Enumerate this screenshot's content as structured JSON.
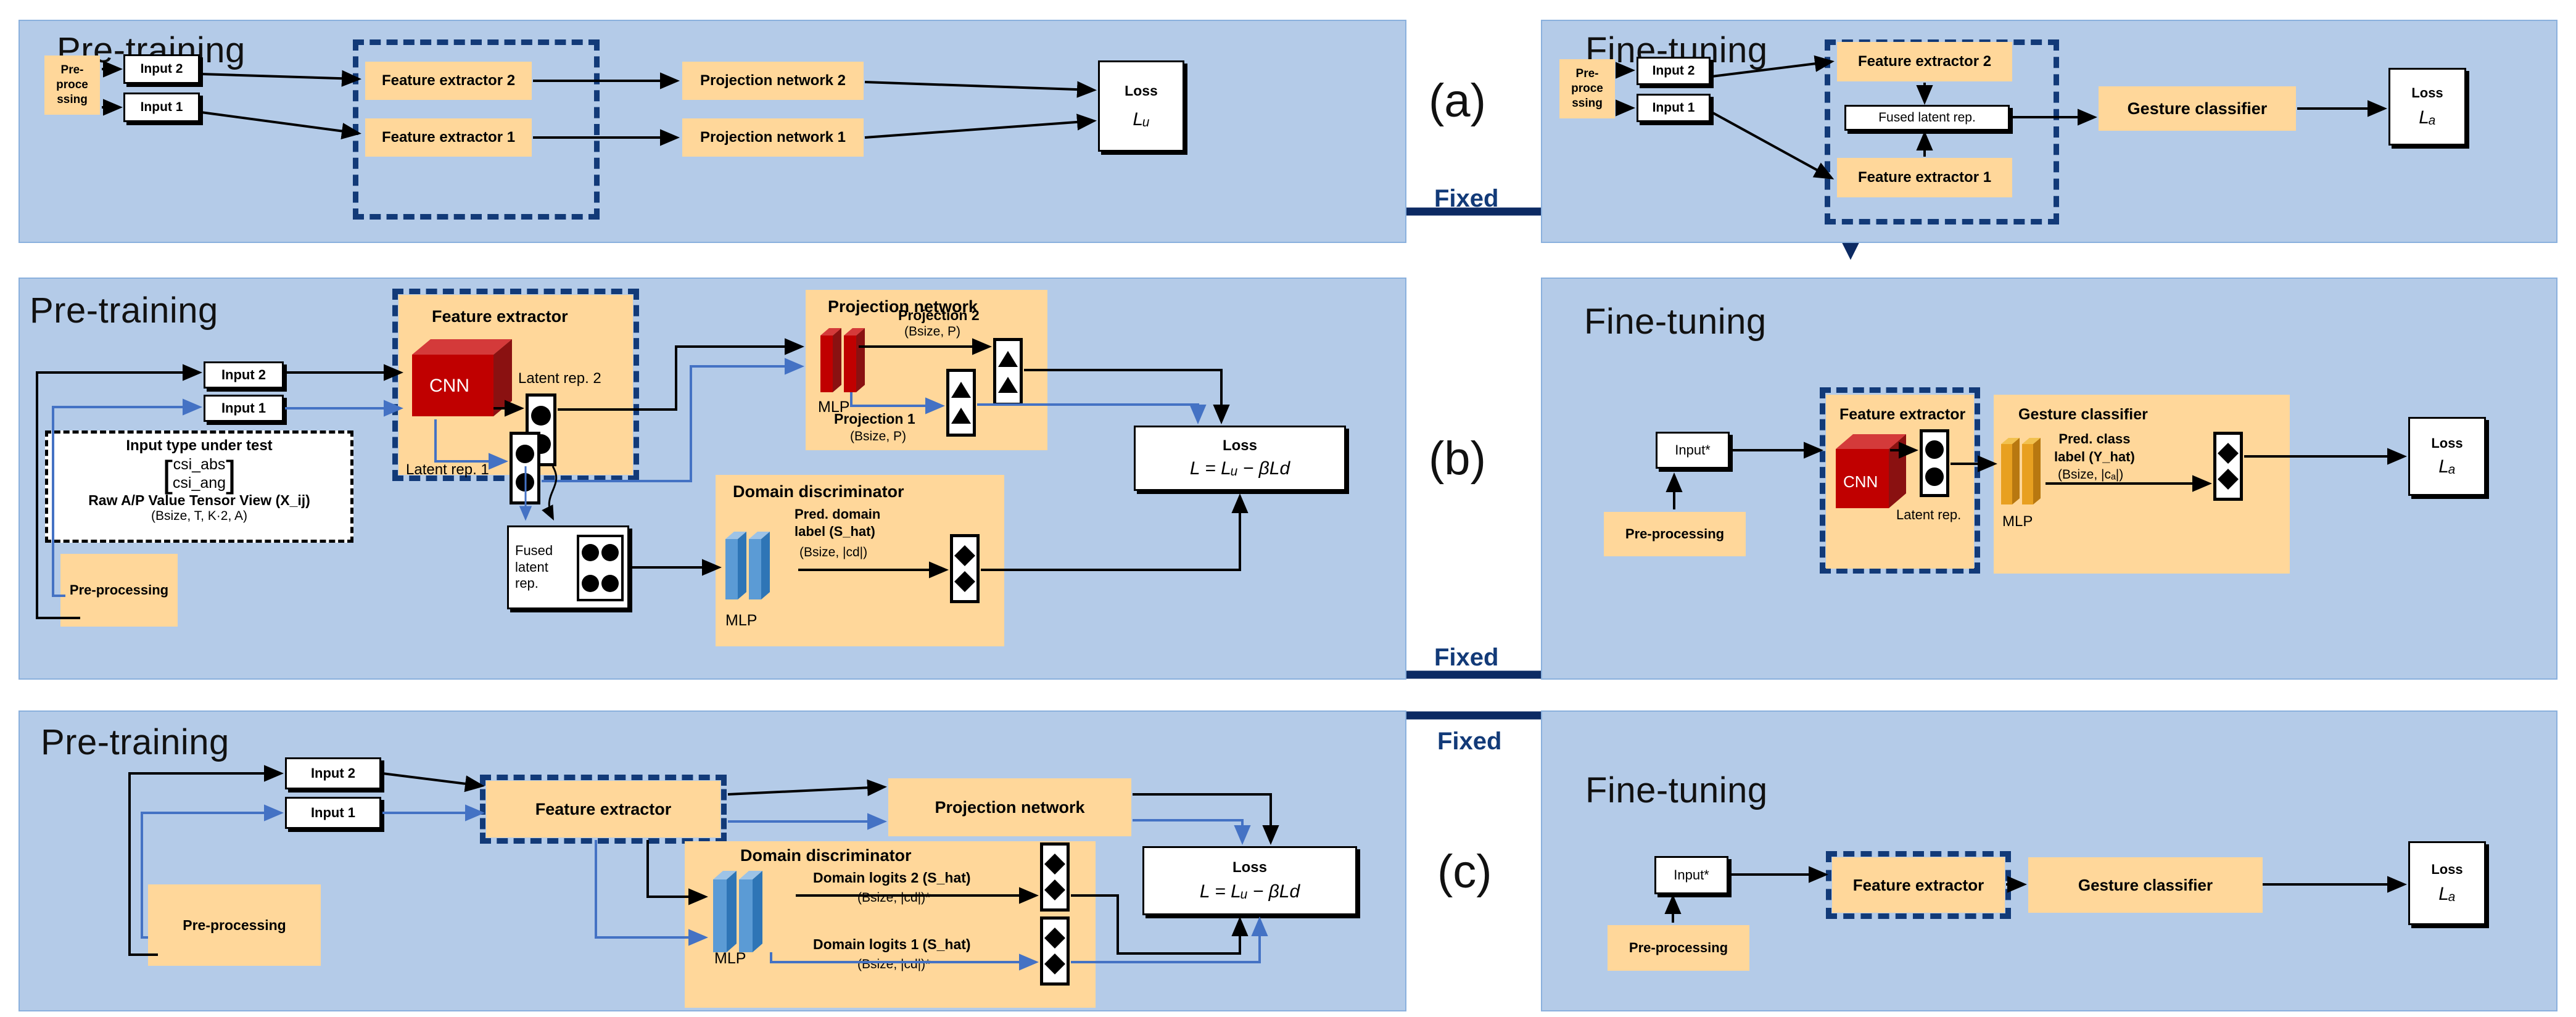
{
  "figure": {
    "panel_tags": [
      "(a)",
      "(b)",
      "(c)"
    ],
    "fixed_label": "Fixed",
    "stage_titles": {
      "pretrain": "Pre-training",
      "finetune": "Fine-tuning"
    }
  },
  "colors": {
    "panel_bg": "#b4cbe8",
    "block_orange": "#ffd79a",
    "cnn_red": "#c00000",
    "mlp_blue": "#5b9bd5",
    "mlp_gold": "#e8a020",
    "fixed_navy": "#0c2a63",
    "flow1_blue": "#4472c4",
    "flow2_black": "#000000"
  },
  "panel_a": {
    "left": {
      "title": "Pre-training",
      "preprocessing": "Pre-\nproce\nssing",
      "inputs": [
        "Input 2",
        "Input 1"
      ],
      "feature_extractors": [
        "Feature extractor 2",
        "Feature extractor 1"
      ],
      "projection_networks": [
        "Projection network 2",
        "Projection network 1"
      ],
      "loss": {
        "label": "Loss",
        "formula": "Lᵤ"
      }
    },
    "right": {
      "title": "Fine-tuning",
      "preprocessing": "Pre-\nproce\nssing",
      "inputs": [
        "Input 2",
        "Input 1"
      ],
      "feature_extractors": [
        "Feature extractor 2",
        "Feature extractor 1"
      ],
      "fused_latent": "Fused latent rep.",
      "gesture_classifier": "Gesture classifier",
      "loss": {
        "label": "Loss",
        "formula": "Lₐ"
      }
    }
  },
  "panel_b": {
    "left": {
      "title": "Pre-training",
      "preprocessing": "Pre-processing",
      "inputs": [
        "Input 2",
        "Input 1"
      ],
      "note": {
        "heading": "Input type under test",
        "matrix_rows": [
          "csi_abs",
          "csi_ang"
        ],
        "caption": "Raw A/P Value Tensor View (X_ij)",
        "shape": "(Bsize, T, K·2, A)"
      },
      "feature_extractor": {
        "title": "Feature extractor",
        "core": "CNN",
        "latent_2": "Latent rep. 2",
        "latent_1": "Latent rep. 1"
      },
      "fused_latent": "Fused\nlatent\nrep.",
      "projection_network": {
        "title": "Projection network",
        "core": "MLP",
        "proj_2_label": "Projection 2",
        "proj_2_shape": "(Bsize, P)",
        "proj_1_label": "Projection 1",
        "proj_1_shape": "(Bsize, P)"
      },
      "domain_discriminator": {
        "title": "Domain discriminator",
        "core": "MLP",
        "output_label": "Pred. domain\nlabel (S_hat)",
        "output_shape": "(Bsize, |cd|)"
      },
      "loss": {
        "label": "Loss",
        "formula": "L = Lᵤ − βLd"
      }
    },
    "right": {
      "title": "Fine-tuning",
      "preprocessing": "Pre-processing",
      "input": "Input*",
      "feature_extractor": {
        "title": "Feature extractor",
        "core": "CNN",
        "latent": "Latent rep."
      },
      "gesture_classifier": {
        "title": "Gesture classifier",
        "core": "MLP",
        "output_label": "Pred. class\nlabel (Y_hat)",
        "output_shape": "(Bsize, |cₐ|)"
      },
      "loss": {
        "label": "Loss",
        "formula": "Lₐ"
      }
    }
  },
  "panel_c": {
    "left": {
      "title": "Pre-training",
      "preprocessing": "Pre-processing",
      "inputs": [
        "Input 2",
        "Input 1"
      ],
      "feature_extractor": "Feature extractor",
      "projection_network": "Projection network",
      "domain_discriminator": {
        "title": "Domain discriminator",
        "core": "MLP",
        "logits_2_label": "Domain logits 2 (S_hat)",
        "logits_2_shape": "(Bsize, |cd|)*",
        "logits_1_label": "Domain logits 1 (S_hat)",
        "logits_1_shape": "(Bsize, |cd|)*"
      },
      "loss": {
        "label": "Loss",
        "formula": "L = Lᵤ − βLd"
      }
    },
    "right": {
      "title": "Fine-tuning",
      "preprocessing": "Pre-processing",
      "input": "Input*",
      "feature_extractor": "Feature extractor",
      "gesture_classifier": "Gesture classifier",
      "loss": {
        "label": "Loss",
        "formula": "Lₐ"
      }
    }
  }
}
